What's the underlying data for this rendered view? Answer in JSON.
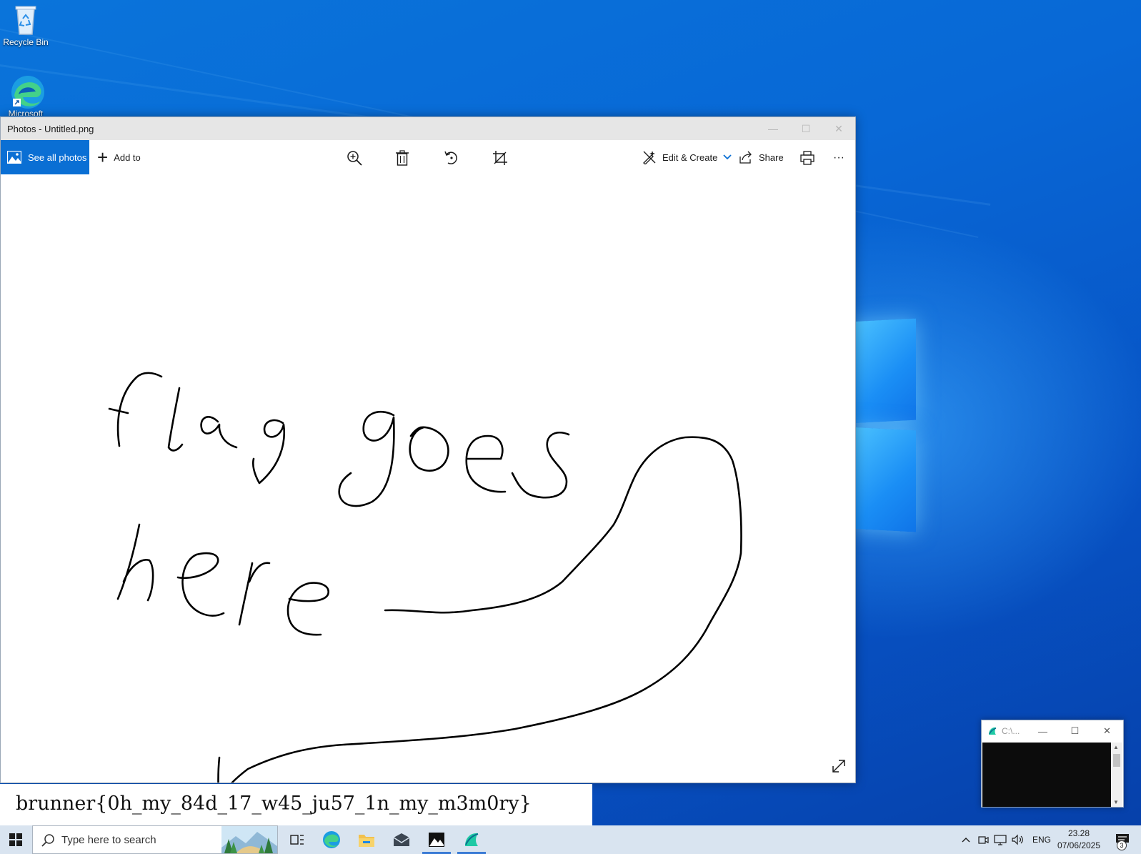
{
  "desktop": {
    "icons": [
      {
        "label": "Recycle Bin",
        "icon": "recycle-bin-icon"
      },
      {
        "label": "Microsoft",
        "icon": "edge-icon"
      }
    ]
  },
  "photos_window": {
    "title": "Photos - Untitled.png",
    "toolbar": {
      "see_all_photos": "See all photos",
      "add_to": "Add to",
      "edit_create": "Edit & Create",
      "share": "Share",
      "more": "···"
    },
    "image": {
      "handwritten_text": [
        "flag goes",
        "here"
      ],
      "ink_color": "#000000"
    }
  },
  "flag_text": "brunner{0h_my_84d_17_w45_ju57_1n_my_m3m0ry}",
  "mini_window": {
    "title": "C:\\..."
  },
  "taskbar": {
    "search_placeholder": "Type here to search",
    "language": "ENG",
    "time": "23.28",
    "date": "07/06/2025",
    "notification_count": "3"
  },
  "colors": {
    "accent": "#0a6fd4",
    "desktop_blue": "#0868d6",
    "taskbar": "#d9e4f0"
  }
}
